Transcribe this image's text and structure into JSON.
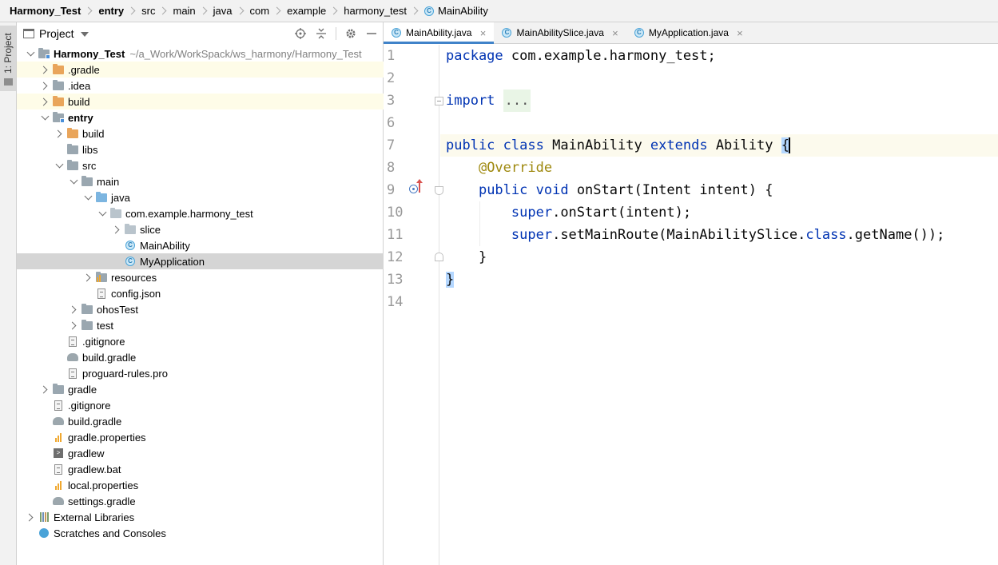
{
  "breadcrumb": [
    "Harmony_Test",
    "entry",
    "src",
    "main",
    "java",
    "com",
    "example",
    "harmony_test",
    "MainAbility"
  ],
  "toolstrip": {
    "project_label": "1: Project"
  },
  "project_panel": {
    "title": "Project"
  },
  "tree": [
    {
      "label": "Harmony_Test",
      "path": "~/a_Work/WorkSpack/ws_harmony/Harmony_Test",
      "bold": true,
      "expanded": true,
      "icon": "module-folder-icon"
    },
    {
      "label": ".gradle",
      "icon": "folder-orange-icon",
      "highlight": true
    },
    {
      "label": ".idea",
      "icon": "folder-icon"
    },
    {
      "label": "build",
      "icon": "folder-orange-icon",
      "highlight": true
    },
    {
      "label": "entry",
      "bold": true,
      "expanded": true,
      "icon": "module-folder-icon"
    },
    {
      "label": "build",
      "icon": "folder-orange-icon"
    },
    {
      "label": "libs",
      "icon": "folder-icon"
    },
    {
      "label": "src",
      "expanded": true,
      "icon": "folder-icon"
    },
    {
      "label": "main",
      "expanded": true,
      "icon": "folder-icon"
    },
    {
      "label": "java",
      "expanded": true,
      "icon": "source-folder-icon"
    },
    {
      "label": "com.example.harmony_test",
      "expanded": true,
      "icon": "package-icon"
    },
    {
      "label": "slice",
      "icon": "package-icon"
    },
    {
      "label": "MainAbility",
      "icon": "java-class-icon"
    },
    {
      "label": "MyApplication",
      "icon": "java-class-icon",
      "selected": true
    },
    {
      "label": "resources",
      "icon": "resources-folder-icon"
    },
    {
      "label": "config.json",
      "icon": "json-file-icon"
    },
    {
      "label": "ohosTest",
      "icon": "folder-icon"
    },
    {
      "label": "test",
      "icon": "folder-icon"
    },
    {
      "label": ".gitignore",
      "icon": "gitignore-file-icon"
    },
    {
      "label": "build.gradle",
      "icon": "gradle-file-icon"
    },
    {
      "label": "proguard-rules.pro",
      "icon": "text-file-icon"
    },
    {
      "label": "gradle",
      "icon": "folder-icon"
    },
    {
      "label": ".gitignore",
      "icon": "gitignore-file-icon"
    },
    {
      "label": "build.gradle",
      "icon": "gradle-file-icon"
    },
    {
      "label": "gradle.properties",
      "icon": "properties-file-icon"
    },
    {
      "label": "gradlew",
      "icon": "shell-script-icon"
    },
    {
      "label": "gradlew.bat",
      "icon": "bat-file-icon"
    },
    {
      "label": "local.properties",
      "icon": "properties-file-icon"
    },
    {
      "label": "settings.gradle",
      "icon": "gradle-file-icon"
    },
    {
      "label": "External Libraries",
      "icon": "external-libraries-icon"
    },
    {
      "label": "Scratches and Consoles",
      "icon": "scratches-icon"
    }
  ],
  "editor": {
    "tabs": [
      {
        "label": "MainAbility.java",
        "active": true
      },
      {
        "label": "MainAbilitySlice.java",
        "active": false
      },
      {
        "label": "MyApplication.java",
        "active": false
      }
    ],
    "line_numbers": [
      "1",
      "2",
      "3",
      "6",
      "7",
      "8",
      "9",
      "10",
      "11",
      "12",
      "13",
      "14"
    ],
    "code": {
      "l1_kw": "package",
      "l1_rest": " com.example.harmony_test;",
      "l3_kw": "import",
      "l3_fold": "...",
      "l7_kw1": "public",
      "l7_kw2": "class",
      "l7_name": " MainAbility ",
      "l7_kw3": "extends",
      "l7_super": " Ability ",
      "l7_brace": "{",
      "l8_ann": "@Override",
      "l9_kw1": "public",
      "l9_kw2": "void",
      "l9_rest": " onStart(Intent intent) {",
      "l10_kw": "super",
      "l10_rest": ".onStart(intent);",
      "l11_kw": "super",
      "l11_mid": ".setMainRoute(MainAbilitySlice.",
      "l11_kw2": "class",
      "l11_end": ".getName());",
      "l12": "}",
      "l13_brace": "}"
    }
  }
}
